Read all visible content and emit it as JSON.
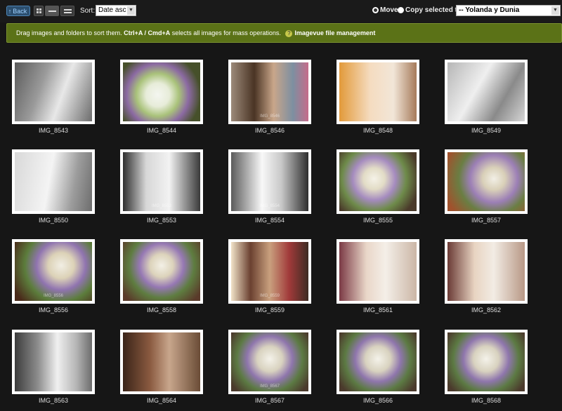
{
  "toolbar": {
    "back_label": "Back",
    "sort_label": "Sort:",
    "sort_value": "Date asc",
    "move_label": "Move",
    "copy_label": "Copy selected to:",
    "target_folder": "-- Yolanda y Dunia"
  },
  "info": {
    "text_before": "Drag images and folders to sort them. ",
    "shortcut": "Ctrl+A / Cmd+A",
    "text_after": " selects all images for mass operations.",
    "help_badge": "?",
    "link_label": "Imagevue file management"
  },
  "images": [
    {
      "name": "IMG_8543",
      "bg": "linear-gradient(110deg,#5a5a5a 0%,#9a9a9a 35%,#e8e8e8 60%,#6c6c6c 100%)",
      "wm": ""
    },
    {
      "name": "IMG_8544",
      "bg": "radial-gradient(circle at 45% 55%,#f4f6f0 0,#e7ecd9 22%,#a9c27a 40%,#8c6aa3 58%,#46502a 80%)",
      "wm": ""
    },
    {
      "name": "IMG_8546",
      "bg": "linear-gradient(90deg,#9c8a7a 0%,#4a3424 30%,#c9a68a 55%,#7d8fa1 80%,#c56c8a 100%)",
      "wm": "IMG_8546"
    },
    {
      "name": "IMG_8548",
      "bg": "linear-gradient(90deg,#e29a3a 0%,#f5dcc0 40%,#f2e6d8 70%,#a57a5a 100%)",
      "wm": ""
    },
    {
      "name": "IMG_8549",
      "bg": "linear-gradient(120deg,#b6b6b6 0%,#efefef 40%,#8a8a8a 70%,#d6d6d6 100%)",
      "wm": ""
    },
    {
      "name": "IMG_8550",
      "bg": "linear-gradient(100deg,#d8d8d8 0%,#f4f4f4 45%,#9c9c9c 75%,#6d6d6d 100%)",
      "wm": ""
    },
    {
      "name": "IMG_8553",
      "bg": "linear-gradient(90deg,#2e2e2e 0%,#d7d7d7 30%,#f2f2f2 60%,#3a3a3a 100%)",
      "wm": "IMG_8553"
    },
    {
      "name": "IMG_8554",
      "bg": "linear-gradient(90deg,#5b5b5b 0%,#f8f8f8 40%,#c8c8c8 65%,#2e2e2e 100%)",
      "wm": "IMG_8554"
    },
    {
      "name": "IMG_8555",
      "bg": "radial-gradient(circle at 45% 45%,#f5f2e8 0,#e2dcc6 20%,#a58bbf 40%,#6e8b4a 60%,#4a3a2a 85%)",
      "wm": ""
    },
    {
      "name": "IMG_8557",
      "bg": "radial-gradient(circle at 60% 45%,#f2efe6 0,#d9d0b8 20%,#9c7fb6 42%,#6a7e43 62%,#a0522d 90%)",
      "wm": ""
    },
    {
      "name": "IMG_8556",
      "bg": "radial-gradient(circle at 60% 40%,#f1eee4 0,#dcd2b7 22%,#9074b0 42%,#5c7d3c 62%,#4a2a1a 90%)",
      "wm": "IMG_8556"
    },
    {
      "name": "IMG_8558",
      "bg": "radial-gradient(circle at 50% 40%,#f3f0e6 0,#dcd3bb 22%,#9678b4 42%,#5e7d40 62%,#5a3a2a 90%)",
      "wm": ""
    },
    {
      "name": "IMG_8559",
      "bg": "linear-gradient(90deg,#f1e2c8 0%,#6a4030 25%,#c9a07e 50%,#a13a3a 75%,#3d2b22 100%)",
      "wm": "IMG_8559"
    },
    {
      "name": "IMG_8561",
      "bg": "linear-gradient(90deg,#7b3a45 0%,#e9d6c8 35%,#f4efe8 60%,#cbb6a6 100%)",
      "wm": ""
    },
    {
      "name": "IMG_8562",
      "bg": "linear-gradient(90deg,#6a3a35 0%,#e8d4c2 35%,#f2ece4 60%,#b89886 100%)",
      "wm": ""
    },
    {
      "name": "IMG_8563",
      "bg": "linear-gradient(90deg,#3c3c3c 0%,#8d8d8d 30%,#f0f0f0 55%,#b4b4b4 80%,#6c6c6c 100%)",
      "wm": ""
    },
    {
      "name": "IMG_8564",
      "bg": "linear-gradient(90deg,#3a2418 0%,#8a5a40 35%,#c8a68c 60%,#6a4c36 100%)",
      "wm": ""
    },
    {
      "name": "IMG_8567",
      "bg": "radial-gradient(circle at 50% 45%,#f4f2ea 0,#d8d2bf 25%,#8f76ad 45%,#5c7a43 65%,#4b3a2c 90%)",
      "wm": "IMG_8567"
    },
    {
      "name": "IMG_8566",
      "bg": "radial-gradient(circle at 50% 45%,#f4f2ea 0,#d8d2bf 25%,#8f76ad 45%,#5c7a43 65%,#4b3a2c 90%)",
      "wm": ""
    },
    {
      "name": "IMG_8568",
      "bg": "radial-gradient(circle at 50% 45%,#f4f2ea 0,#d8d2bf 25%,#8f76ad 45%,#5c7a43 65%,#4b3a2c 90%)",
      "wm": ""
    }
  ]
}
